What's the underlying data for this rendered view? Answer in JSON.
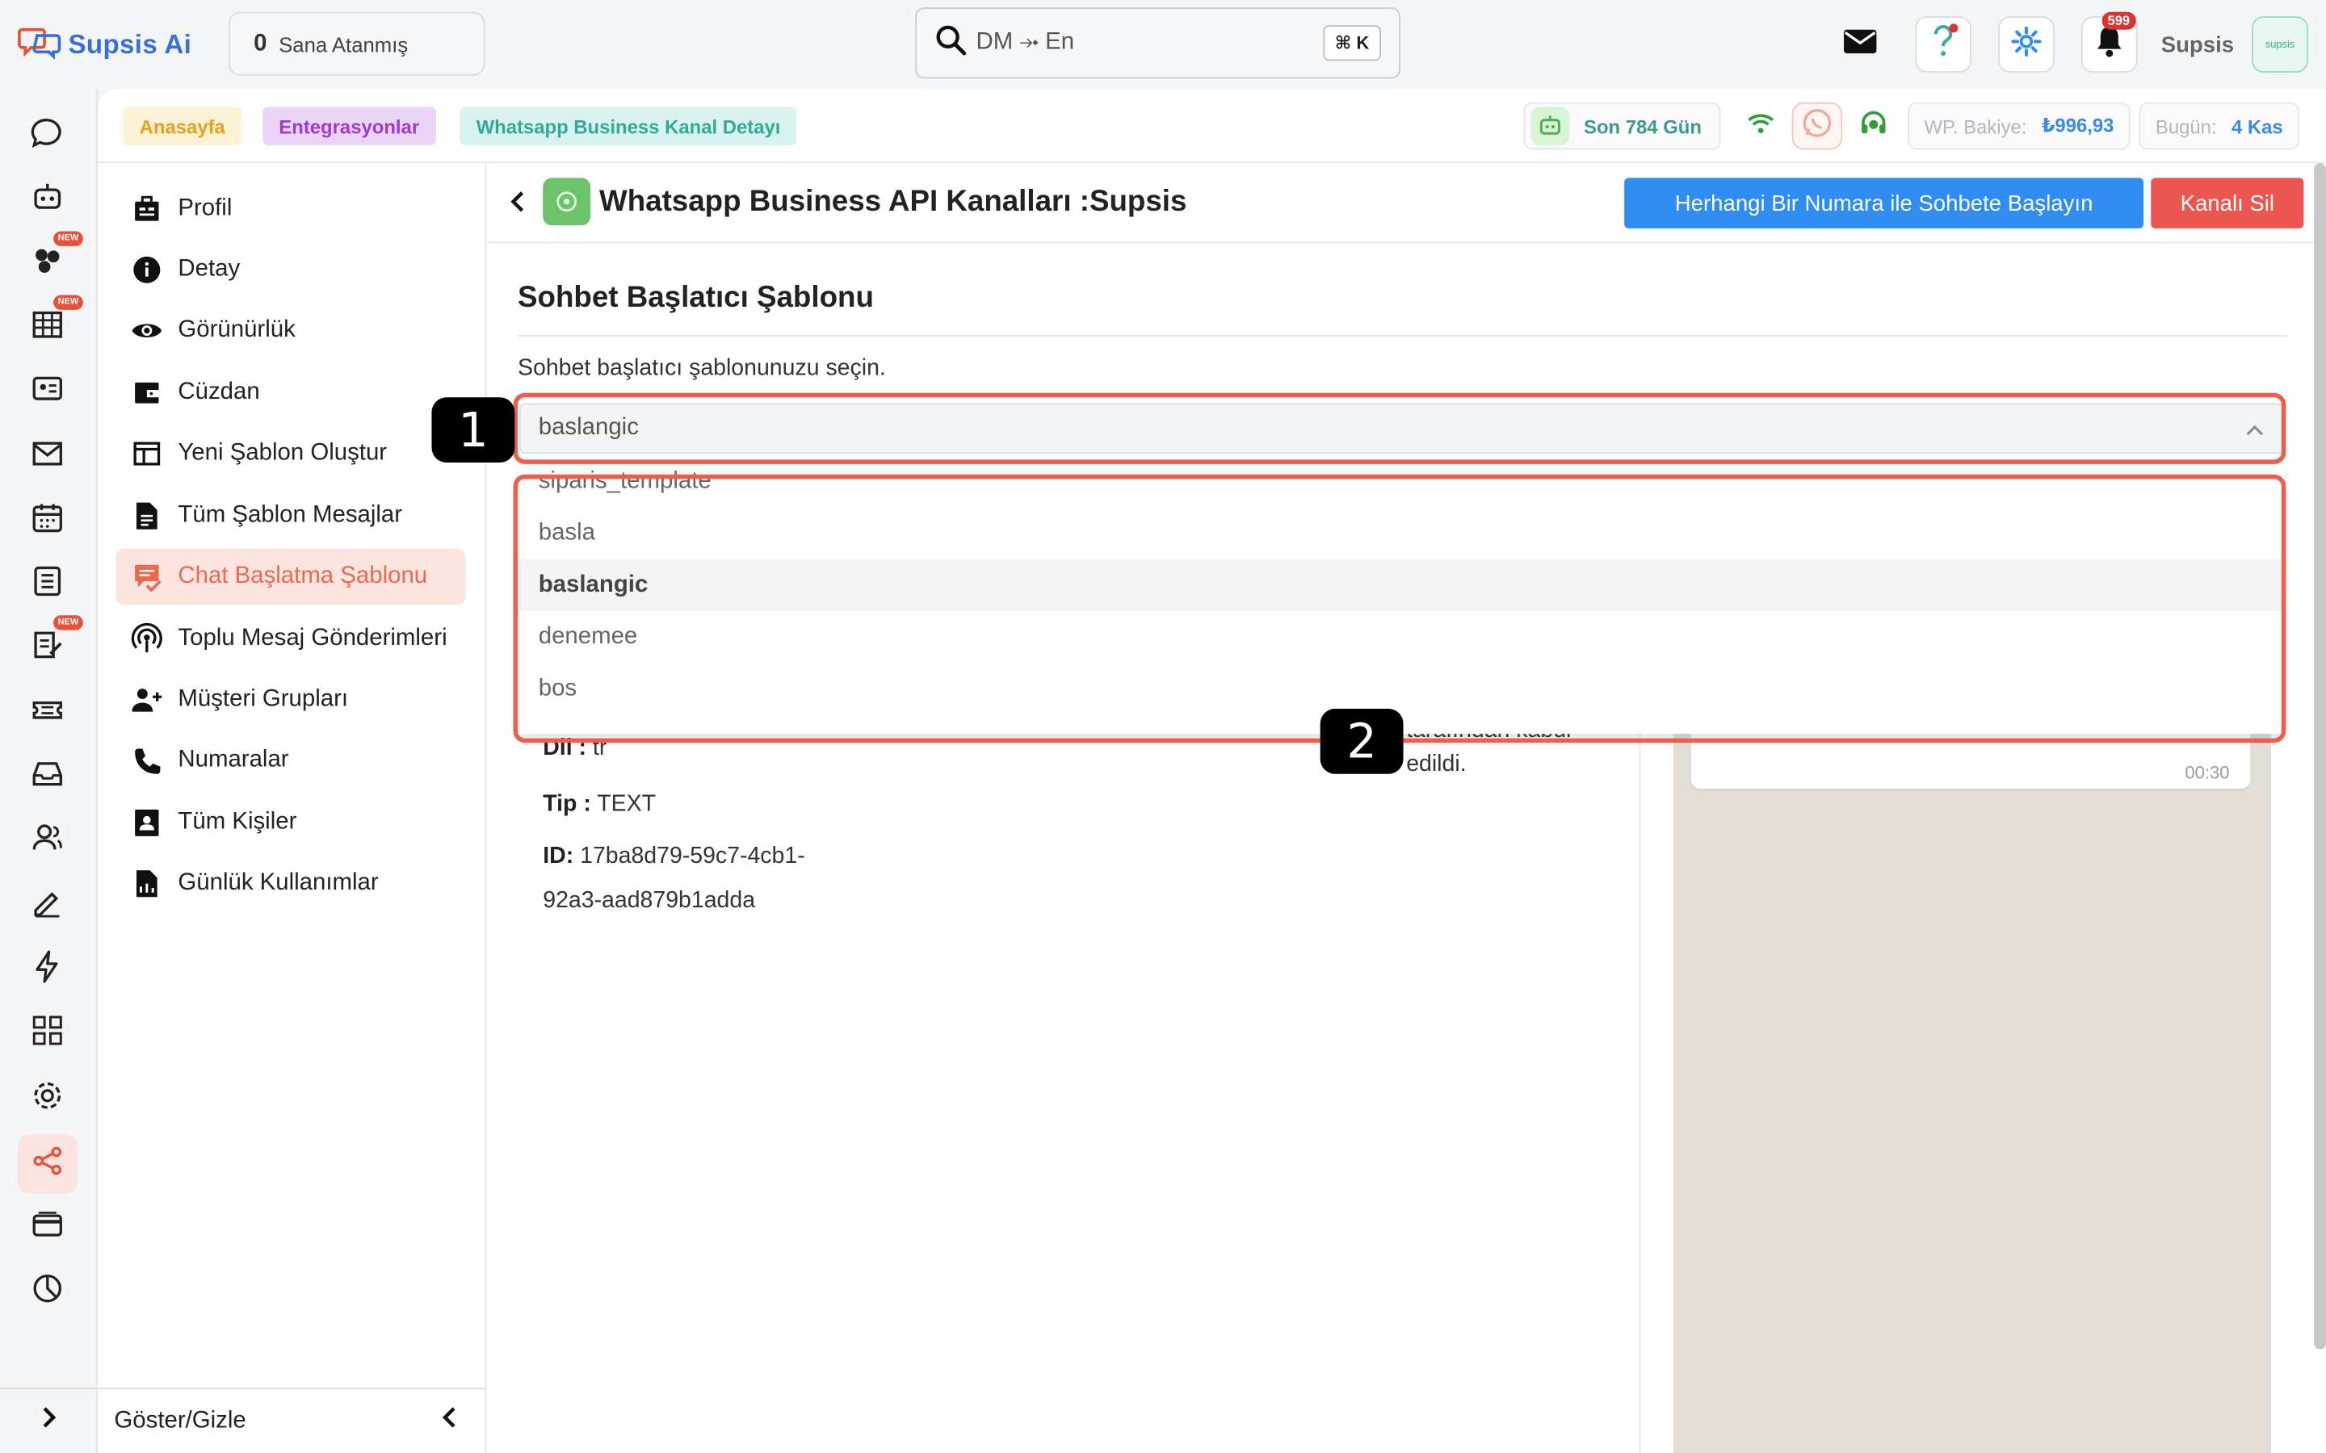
{
  "app": {
    "logo_text": "Supsis Ai",
    "assigned_count": "0",
    "assigned_label": "Sana Atanmış",
    "search_value": "DM ⤞ En",
    "search_shortcut": "⌘ K",
    "notifications_count": "599",
    "user_name": "Supsis",
    "avatar_text": "supsis"
  },
  "rail": {
    "new_badge": "NEW"
  },
  "breadcrumb": {
    "items": [
      "Anasayfa",
      "Entegrasyonlar",
      "Whatsapp Business Kanal Detayı"
    ]
  },
  "status": {
    "son_gun": "Son 784 Gün",
    "wp_bakiye_label": "WP. Bakiye:",
    "wp_bakiye_value": "₺996,93",
    "bugun_label": "Bugün:",
    "bugun_value": "4 Kas"
  },
  "sidebar": {
    "items": [
      {
        "label": "Profil",
        "icon": "briefcase-icon"
      },
      {
        "label": "Detay",
        "icon": "info-icon"
      },
      {
        "label": "Görünürlük",
        "icon": "eye-icon"
      },
      {
        "label": "Cüzdan",
        "icon": "wallet-icon"
      },
      {
        "label": "Yeni Şablon Oluştur",
        "icon": "template-icon"
      },
      {
        "label": "Tüm Şablon Mesajlar",
        "icon": "document-icon"
      },
      {
        "label": "Chat Başlatma Şablonu",
        "icon": "chat-check-icon"
      },
      {
        "label": "Toplu Mesaj Gönderimleri",
        "icon": "broadcast-icon"
      },
      {
        "label": "Müşteri Grupları",
        "icon": "group-add-icon"
      },
      {
        "label": "Numaralar",
        "icon": "phone-icon"
      },
      {
        "label": "Tüm Kişiler",
        "icon": "contacts-icon"
      },
      {
        "label": "Günlük Kullanımlar",
        "icon": "usage-icon"
      }
    ],
    "active_index": 6,
    "footer_label": "Göster/Gizle"
  },
  "main": {
    "title": "Whatsapp Business API Kanalları :Supsis",
    "start_chat_button": "Herhangi Bir Numara ile Sohbete Başlayın",
    "delete_channel_button": "Kanalı Sil",
    "section_title": "Sohbet Başlatıcı Şablonu",
    "section_desc": "Sohbet başlatıcı şablonunuzu seçin.",
    "select_value": "baslangic",
    "options": [
      "siparis_template",
      "basla",
      "baslangic",
      "denemee",
      "bos"
    ],
    "selected_option": "baslangic",
    "details": {
      "dil_label": "Dil :",
      "dil_value": "tr",
      "tip_label": "Tip :",
      "tip_value": "TEXT",
      "id_label": "ID:",
      "id_value_line1": "17ba8d79-59c7-4cb1-",
      "id_value_line2": "92a3-aad879b1adda",
      "status_partial": "tarafından kabul",
      "status_line2": "edildi."
    },
    "chat_time": "00:30"
  },
  "annotations": {
    "marker1": "1",
    "marker2": "2"
  },
  "colors": {
    "accent_blue": "#2f8cf0",
    "danger_red": "#ec5650",
    "annotation_red": "#ee5d4d",
    "active_sidebar_bg": "#fce4df",
    "active_sidebar_text": "#e86a53"
  }
}
